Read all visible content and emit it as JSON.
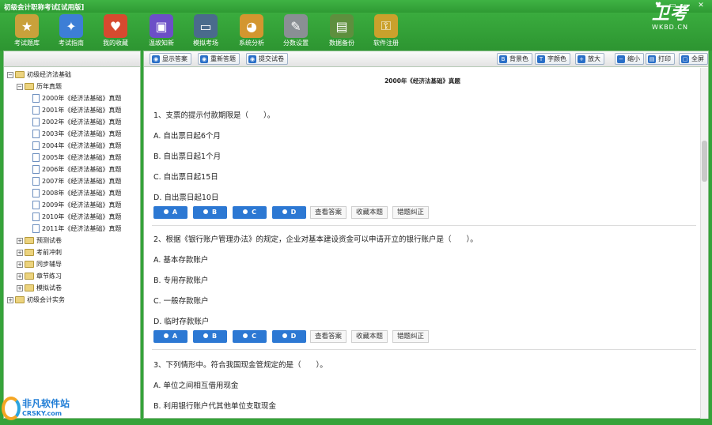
{
  "window": {
    "title": "初级会计职称考试[试用版]",
    "controls": [
      "♥",
      "▭",
      "—",
      "✕"
    ]
  },
  "toolbar": {
    "items": [
      {
        "label": "考试题库",
        "icon": "book-icon",
        "color": "#c9a13b",
        "glyph": "★"
      },
      {
        "label": "考试指南",
        "icon": "compass-icon",
        "color": "#3d7ed6",
        "glyph": "✦"
      },
      {
        "label": "我的收藏",
        "icon": "favorite-box-icon",
        "color": "#d64a2f",
        "glyph": "♥"
      },
      {
        "label": "温故知新",
        "icon": "cubes-icon",
        "color": "#6c4fc7",
        "glyph": "▣"
      },
      {
        "label": "模拟考场",
        "icon": "monitor-user-icon",
        "color": "#4a6b8c",
        "glyph": "▭"
      },
      {
        "label": "系统分析",
        "icon": "pie-chart-icon",
        "color": "#d3962f",
        "glyph": "◕"
      },
      {
        "label": "分数设置",
        "icon": "tools-icon",
        "color": "#8a8f94",
        "glyph": "✎"
      },
      {
        "label": "数据备份",
        "icon": "backup-drive-icon",
        "color": "#5e8f3e",
        "glyph": "▤"
      },
      {
        "label": "软件注册",
        "icon": "lock-icon",
        "color": "#caa12c",
        "glyph": "⚿"
      }
    ]
  },
  "brand": {
    "logo": "卫考",
    "sub": "WKBD.CN"
  },
  "tree": {
    "nodes": [
      {
        "label": "初级经济法基础",
        "level": 0,
        "type": "root",
        "expand": "−"
      },
      {
        "label": "历年真题",
        "level": 1,
        "type": "folder",
        "expand": "−"
      },
      {
        "label": "2000年《经济法基础》真题",
        "level": 2,
        "type": "doc"
      },
      {
        "label": "2001年《经济法基础》真题",
        "level": 2,
        "type": "doc"
      },
      {
        "label": "2002年《经济法基础》真题",
        "level": 2,
        "type": "doc"
      },
      {
        "label": "2003年《经济法基础》真题",
        "level": 2,
        "type": "doc"
      },
      {
        "label": "2004年《经济法基础》真题",
        "level": 2,
        "type": "doc"
      },
      {
        "label": "2005年《经济法基础》真题",
        "level": 2,
        "type": "doc"
      },
      {
        "label": "2006年《经济法基础》真题",
        "level": 2,
        "type": "doc"
      },
      {
        "label": "2007年《经济法基础》真题",
        "level": 2,
        "type": "doc"
      },
      {
        "label": "2008年《经济法基础》真题",
        "level": 2,
        "type": "doc"
      },
      {
        "label": "2009年《经济法基础》真题",
        "level": 2,
        "type": "doc"
      },
      {
        "label": "2010年《经济法基础》真题",
        "level": 2,
        "type": "doc"
      },
      {
        "label": "2011年《经济法基础》真题",
        "level": 2,
        "type": "doc"
      },
      {
        "label": "预测试卷",
        "level": 1,
        "type": "folder",
        "expand": "+"
      },
      {
        "label": "考前冲刺",
        "level": 1,
        "type": "folder",
        "expand": "+"
      },
      {
        "label": "同步辅导",
        "level": 1,
        "type": "folder",
        "expand": "+"
      },
      {
        "label": "章节练习",
        "level": 1,
        "type": "folder",
        "expand": "+"
      },
      {
        "label": "模拟试卷",
        "level": 1,
        "type": "folder",
        "expand": "+"
      },
      {
        "label": "初级会计实务",
        "level": 0,
        "type": "root",
        "expand": "+"
      }
    ]
  },
  "maintools": {
    "left": [
      {
        "label": "显示答案",
        "icon": "show-answer-icon"
      },
      {
        "label": "重新答题",
        "icon": "redo-icon"
      },
      {
        "label": "提交试卷",
        "icon": "submit-icon"
      }
    ],
    "right": [
      {
        "label": "背景色",
        "icon": "background-color-icon",
        "glyph": "B"
      },
      {
        "label": "字颜色",
        "icon": "font-color-icon",
        "glyph": "T"
      },
      {
        "label": "放大",
        "icon": "zoom-in-icon",
        "glyph": "+"
      },
      {
        "label": "缩小",
        "icon": "zoom-out-icon",
        "glyph": "−"
      },
      {
        "label": "打印",
        "icon": "print-icon",
        "glyph": "▤"
      },
      {
        "label": "全屏",
        "icon": "fullscreen-icon",
        "glyph": "▢"
      }
    ]
  },
  "paper": {
    "title": "2000年《经济法基础》真题"
  },
  "questions": [
    {
      "text": "1、支票的提示付款期限是（　　）。",
      "options": [
        "A.  自出票日起6个月",
        "B.  自出票日起1个月",
        "C.  自出票日起15日",
        "D.  自出票日起10日"
      ]
    },
    {
      "text": "2、根据《银行账户管理办法》的规定，企业对基本建设资金可以申请开立的银行账户是（　　）。",
      "options": [
        "A.  基本存款账户",
        "B.  专用存款账户",
        "C.  一般存款账户",
        "D.  临时存款账户"
      ]
    },
    {
      "text": "3、下列情形中。符合我国现金管规定的是（　　）。",
      "options": [
        "A.  单位之间相互借用现金",
        "B.  利用银行账户代其他单位支取现金"
      ]
    }
  ],
  "answer_buttons": [
    "A",
    "B",
    "C",
    "D"
  ],
  "action_buttons": [
    "查看答案",
    "收藏本题",
    "错题纠正"
  ],
  "watermark": {
    "line1": "非凡软件站",
    "line2": "CRSKY.com"
  }
}
